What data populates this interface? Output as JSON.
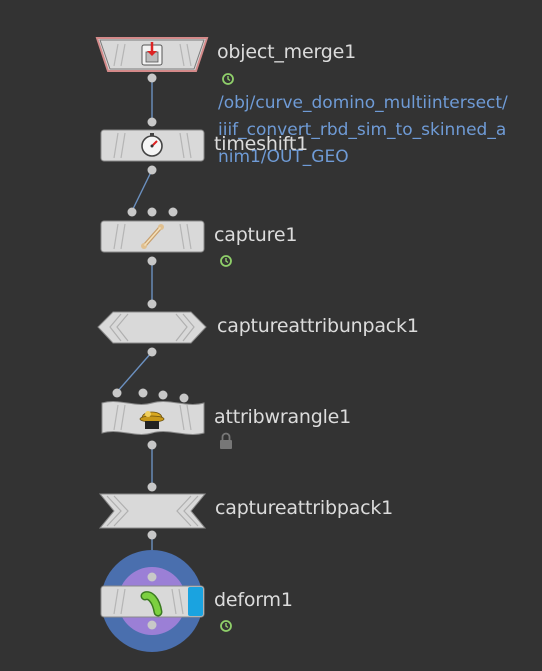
{
  "network": {
    "nodes": [
      {
        "id": "object_merge1",
        "label": "object_merge1",
        "icon": "object-merge-icon",
        "shape": "trapezoid",
        "time_dependent": true,
        "object_path": [
          "/obj/curve_domino_multiintersect/",
          "iiif_convert_rbd_sim_to_skinned_a",
          "nim1/OUT_GEO"
        ]
      },
      {
        "id": "timeshift1",
        "label": "timeshift1",
        "icon": "stopwatch-icon",
        "shape": "rect"
      },
      {
        "id": "capture1",
        "label": "capture1",
        "icon": "bone-capture-icon",
        "shape": "rect",
        "time_dependent": true
      },
      {
        "id": "captureattribunpack1",
        "label": "captureattribunpack1",
        "shape": "chevron-out"
      },
      {
        "id": "attribwrangle1",
        "label": "attribwrangle1",
        "icon": "wrangle-cowboy-icon",
        "shape": "wavy",
        "locked": true
      },
      {
        "id": "captureattribpack1",
        "label": "captureattribpack1",
        "shape": "chevron-in"
      },
      {
        "id": "deform1",
        "label": "deform1",
        "icon": "deform-bend-icon",
        "shape": "rect",
        "display_flag": true,
        "template_ring": true,
        "time_dependent": true
      }
    ],
    "colors": {
      "background": "#333333",
      "node_fill": "#d9d9d9",
      "node_stroke": "#8a8a8a",
      "wire": "#6b90c0",
      "connector": "#c8c8c8",
      "label": "#dcdcdc",
      "path_text": "#6f9bd6",
      "time_badge": "#8fcf6a",
      "display_flag": "#1aa3e0",
      "ring_outer": "#4a6fae",
      "ring_inner": "#9b7fd6",
      "merge_border": "#d48a8a"
    }
  }
}
